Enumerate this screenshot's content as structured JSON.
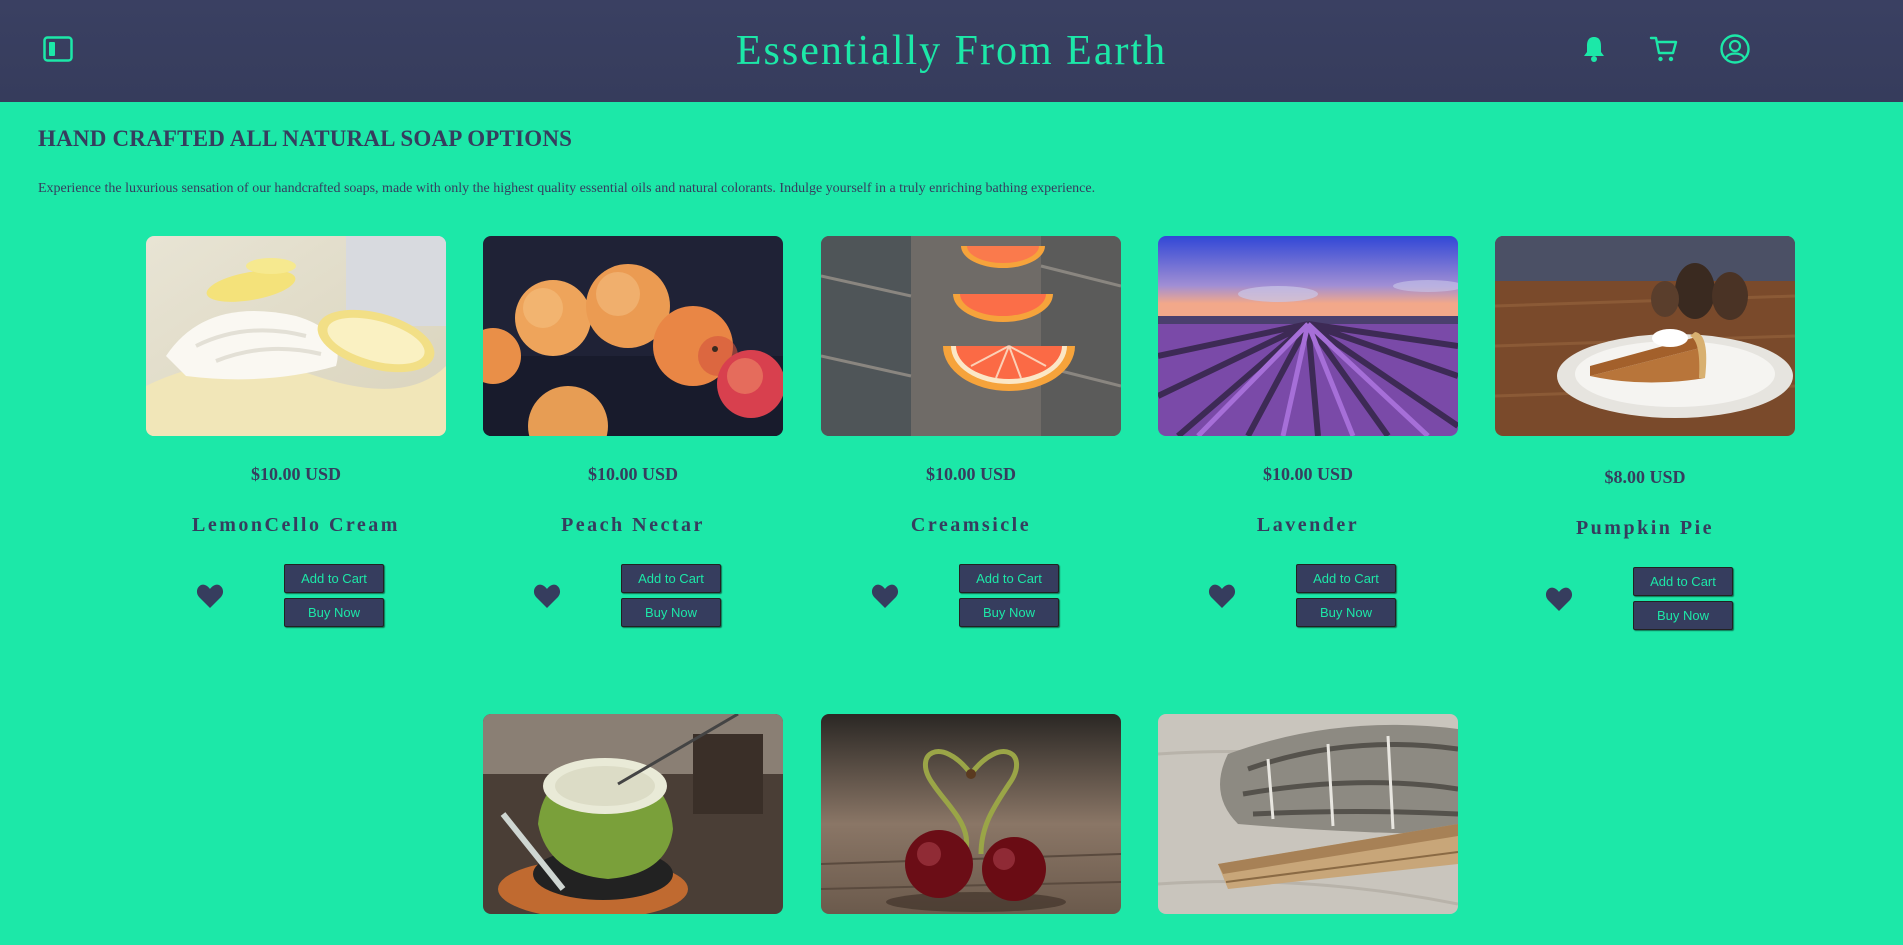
{
  "header": {
    "title": "Essentially From Earth",
    "icons": [
      "sidebar-toggle-icon",
      "bell-icon",
      "cart-icon",
      "user-icon"
    ],
    "accent_color": "#1ce8a8",
    "background_color": "#363c5c"
  },
  "section": {
    "heading": "HAND CRAFTED ALL NATURAL SOAP OPTIONS",
    "intro": "Experience the luxurious sensation of our handcrafted soaps, made with only the highest quality essential oils and natural colorants. Indulge yourself in a truly enriching bathing experience."
  },
  "products": [
    {
      "name": "LemonCello Cream",
      "price": "$10.00 USD",
      "add_label": "Add to Cart",
      "buy_label": "Buy Now",
      "image": "lemon-cream-photo"
    },
    {
      "name": "Peach Nectar",
      "price": "$10.00 USD",
      "add_label": "Add to Cart",
      "buy_label": "Buy Now",
      "image": "apricots-photo"
    },
    {
      "name": "Creamsicle",
      "price": "$10.00 USD",
      "add_label": "Add to Cart",
      "buy_label": "Buy Now",
      "image": "orange-slices-photo"
    },
    {
      "name": "Lavender",
      "price": "$10.00 USD",
      "add_label": "Add to Cart",
      "buy_label": "Buy Now",
      "image": "lavender-field-photo"
    },
    {
      "name": "Pumpkin Pie",
      "price": "$8.00 USD",
      "add_label": "Add to Cart",
      "buy_label": "Buy Now",
      "image": "pumpkin-pie-photo"
    },
    {
      "image": "coconut-photo"
    },
    {
      "image": "cherries-photo"
    },
    {
      "image": "sage-bundle-photo"
    }
  ]
}
